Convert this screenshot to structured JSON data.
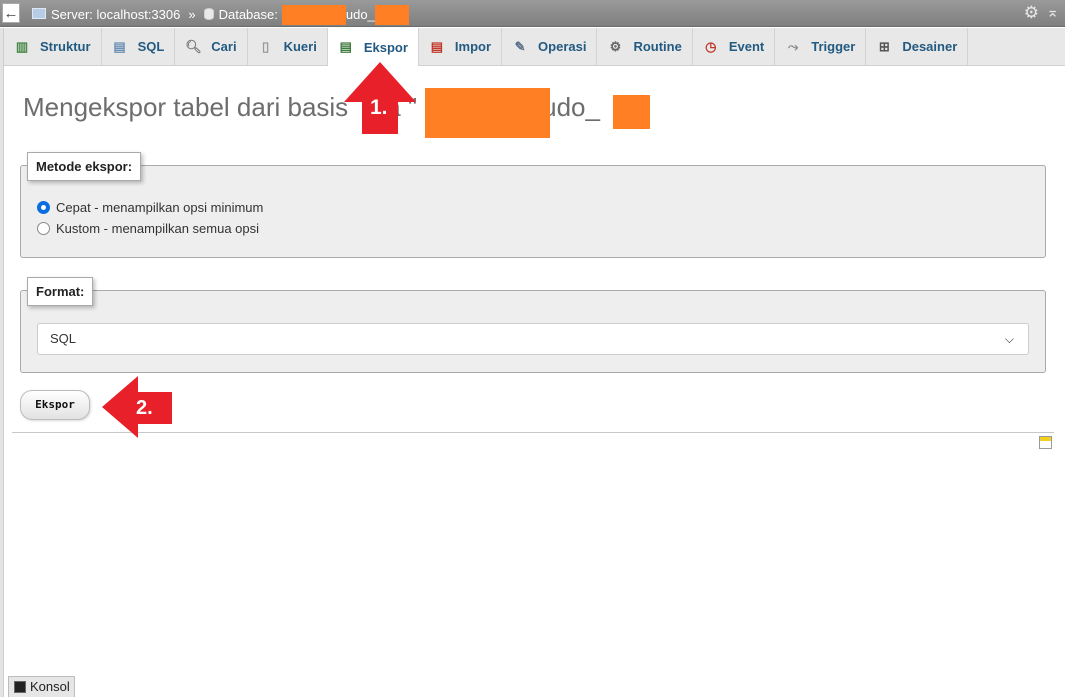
{
  "breadcrumb": {
    "back_glyph": "←",
    "server_label": "Server: localhost:3306",
    "separator": "»",
    "database_label": "Database:",
    "database_name_visible": "udo_"
  },
  "tabs": [
    {
      "label": "Struktur",
      "icon": "structure-icon"
    },
    {
      "label": "SQL",
      "icon": "sql-icon"
    },
    {
      "label": "Cari",
      "icon": "search-icon"
    },
    {
      "label": "Kueri",
      "icon": "query-icon"
    },
    {
      "label": "Ekspor",
      "icon": "export-icon",
      "active": true
    },
    {
      "label": "Impor",
      "icon": "import-icon"
    },
    {
      "label": "Operasi",
      "icon": "wrench-icon"
    },
    {
      "label": "Routine",
      "icon": "routine-icon"
    },
    {
      "label": "Event",
      "icon": "clock-icon"
    },
    {
      "label": "Trigger",
      "icon": "trigger-icon"
    },
    {
      "label": "Desainer",
      "icon": "designer-icon"
    }
  ],
  "page": {
    "title_start": "Mengekspor tabel dari basis",
    "title_mid": "a \"",
    "title_end": "udo_"
  },
  "export_method": {
    "legend": "Metode ekspor:",
    "options": [
      {
        "label": "Cepat - menampilkan opsi minimum",
        "checked": true
      },
      {
        "label": "Kustom - menampilkan semua opsi",
        "checked": false
      }
    ]
  },
  "format": {
    "legend": "Format:",
    "selected": "SQL"
  },
  "export_button": "Ekspor",
  "console_label": "Konsol",
  "annotations": {
    "step1": "1.",
    "step2": "2."
  },
  "colors": {
    "redaction": "#ff8024",
    "annotation_red": "#e8202a",
    "tab_text": "#235a81"
  }
}
